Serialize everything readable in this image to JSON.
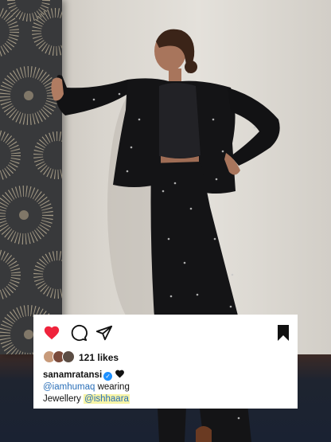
{
  "post": {
    "likes": "121 likes",
    "username": "sanamratansi",
    "mention": "@iamhumaq",
    "caption_text": " wearing",
    "caption_line2": "Jewellery ",
    "tag": "@ishhaara"
  },
  "colors": {
    "like_red": "#ef233c",
    "link_blue": "#2a6fb8",
    "tag_highlight": "#f6f3a6",
    "card_bg": "#ffffff"
  },
  "icons": {
    "like": "heart-icon",
    "comment": "comment-bubble-icon",
    "share": "paper-plane-icon",
    "save": "bookmark-icon",
    "verified": "verified-badge-icon",
    "caption_emoji": "black-heart-icon"
  }
}
